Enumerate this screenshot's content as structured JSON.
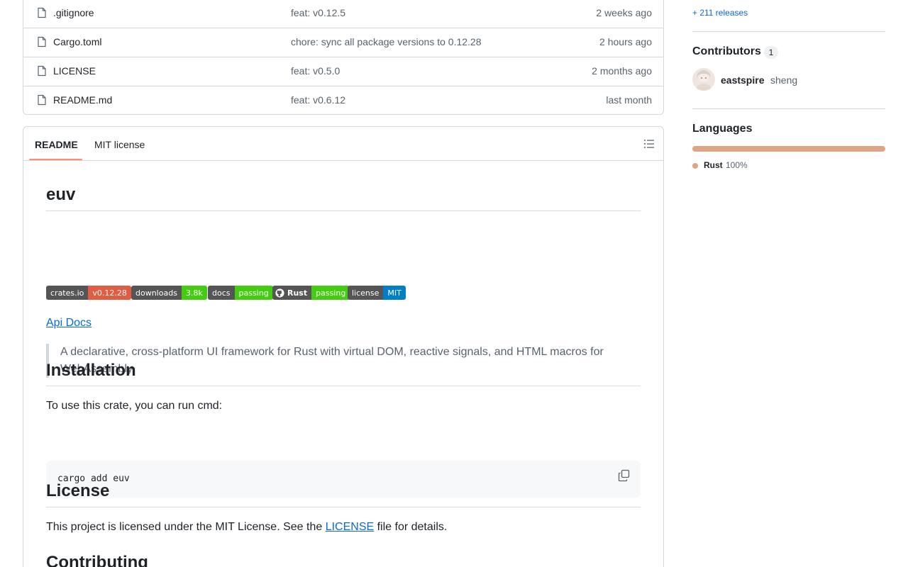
{
  "files": [
    {
      "name": ".gitignore",
      "message": "feat: v0.12.5",
      "time": "2 weeks ago"
    },
    {
      "name": "Cargo.toml",
      "message": "chore: sync all package versions to 0.12.28",
      "time": "2 hours ago"
    },
    {
      "name": "LICENSE",
      "message": "feat: v0.5.0",
      "time": "2 months ago"
    },
    {
      "name": "README.md",
      "message": "feat: v0.6.12",
      "time": "last month"
    }
  ],
  "readme": {
    "tabs": {
      "readme": "README",
      "license": "MIT license"
    },
    "title": "euv",
    "badges": [
      {
        "label": "crates.io",
        "value": "v0.12.28",
        "color": "#e05d44"
      },
      {
        "label": "downloads",
        "value": "3.8k",
        "color": "#4c1"
      },
      {
        "label": "docs",
        "value": "passing",
        "color": "#4c1"
      },
      {
        "label": "Rust",
        "value": "passing",
        "color": "#4c1"
      },
      {
        "label": "license",
        "value": "MIT",
        "color": "#007ec6"
      }
    ],
    "api_docs": "Api Docs",
    "quote_line1": "A declarative, cross-platform UI framework for Rust with virtual DOM, reactive signals, and HTML macros for",
    "quote_line2": "WebAssembly.",
    "installation_heading": "Installation",
    "installation_text": "To use this crate, you can run cmd:",
    "code": "cargo add euv",
    "license_heading": "License",
    "license_text_before": "This project is licensed under the MIT License. See the ",
    "license_link": "LICENSE",
    "license_text_after": " file for details.",
    "contributing_heading": "Contributing"
  },
  "sidebar": {
    "releases": "+ 211 releases",
    "contributors_heading": "Contributors",
    "contributors_count": "1",
    "contributor_login": "eastspire",
    "contributor_name": "sheng",
    "languages_heading": "Languages",
    "language_name": "Rust",
    "language_percent": "100%",
    "language_color": "#dea584"
  }
}
